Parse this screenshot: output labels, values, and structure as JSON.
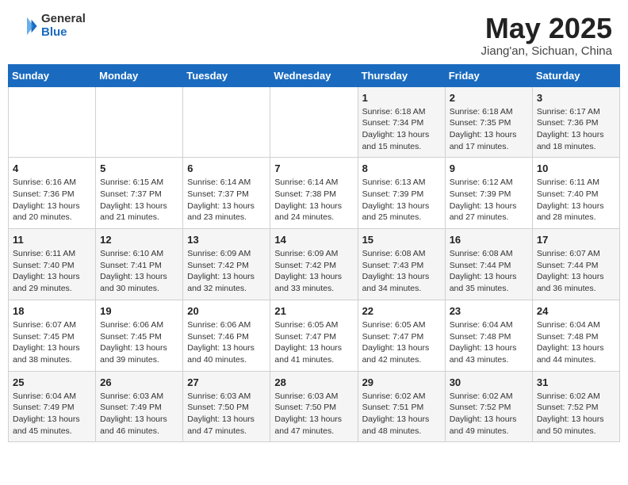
{
  "header": {
    "logo_general": "General",
    "logo_blue": "Blue",
    "title": "May 2025",
    "subtitle": "Jiang'an, Sichuan, China"
  },
  "weekdays": [
    "Sunday",
    "Monday",
    "Tuesday",
    "Wednesday",
    "Thursday",
    "Friday",
    "Saturday"
  ],
  "weeks": [
    [
      {
        "day": "",
        "info": ""
      },
      {
        "day": "",
        "info": ""
      },
      {
        "day": "",
        "info": ""
      },
      {
        "day": "",
        "info": ""
      },
      {
        "day": "1",
        "info": "Sunrise: 6:18 AM\nSunset: 7:34 PM\nDaylight: 13 hours\nand 15 minutes."
      },
      {
        "day": "2",
        "info": "Sunrise: 6:18 AM\nSunset: 7:35 PM\nDaylight: 13 hours\nand 17 minutes."
      },
      {
        "day": "3",
        "info": "Sunrise: 6:17 AM\nSunset: 7:36 PM\nDaylight: 13 hours\nand 18 minutes."
      }
    ],
    [
      {
        "day": "4",
        "info": "Sunrise: 6:16 AM\nSunset: 7:36 PM\nDaylight: 13 hours\nand 20 minutes."
      },
      {
        "day": "5",
        "info": "Sunrise: 6:15 AM\nSunset: 7:37 PM\nDaylight: 13 hours\nand 21 minutes."
      },
      {
        "day": "6",
        "info": "Sunrise: 6:14 AM\nSunset: 7:37 PM\nDaylight: 13 hours\nand 23 minutes."
      },
      {
        "day": "7",
        "info": "Sunrise: 6:14 AM\nSunset: 7:38 PM\nDaylight: 13 hours\nand 24 minutes."
      },
      {
        "day": "8",
        "info": "Sunrise: 6:13 AM\nSunset: 7:39 PM\nDaylight: 13 hours\nand 25 minutes."
      },
      {
        "day": "9",
        "info": "Sunrise: 6:12 AM\nSunset: 7:39 PM\nDaylight: 13 hours\nand 27 minutes."
      },
      {
        "day": "10",
        "info": "Sunrise: 6:11 AM\nSunset: 7:40 PM\nDaylight: 13 hours\nand 28 minutes."
      }
    ],
    [
      {
        "day": "11",
        "info": "Sunrise: 6:11 AM\nSunset: 7:40 PM\nDaylight: 13 hours\nand 29 minutes."
      },
      {
        "day": "12",
        "info": "Sunrise: 6:10 AM\nSunset: 7:41 PM\nDaylight: 13 hours\nand 30 minutes."
      },
      {
        "day": "13",
        "info": "Sunrise: 6:09 AM\nSunset: 7:42 PM\nDaylight: 13 hours\nand 32 minutes."
      },
      {
        "day": "14",
        "info": "Sunrise: 6:09 AM\nSunset: 7:42 PM\nDaylight: 13 hours\nand 33 minutes."
      },
      {
        "day": "15",
        "info": "Sunrise: 6:08 AM\nSunset: 7:43 PM\nDaylight: 13 hours\nand 34 minutes."
      },
      {
        "day": "16",
        "info": "Sunrise: 6:08 AM\nSunset: 7:44 PM\nDaylight: 13 hours\nand 35 minutes."
      },
      {
        "day": "17",
        "info": "Sunrise: 6:07 AM\nSunset: 7:44 PM\nDaylight: 13 hours\nand 36 minutes."
      }
    ],
    [
      {
        "day": "18",
        "info": "Sunrise: 6:07 AM\nSunset: 7:45 PM\nDaylight: 13 hours\nand 38 minutes."
      },
      {
        "day": "19",
        "info": "Sunrise: 6:06 AM\nSunset: 7:45 PM\nDaylight: 13 hours\nand 39 minutes."
      },
      {
        "day": "20",
        "info": "Sunrise: 6:06 AM\nSunset: 7:46 PM\nDaylight: 13 hours\nand 40 minutes."
      },
      {
        "day": "21",
        "info": "Sunrise: 6:05 AM\nSunset: 7:47 PM\nDaylight: 13 hours\nand 41 minutes."
      },
      {
        "day": "22",
        "info": "Sunrise: 6:05 AM\nSunset: 7:47 PM\nDaylight: 13 hours\nand 42 minutes."
      },
      {
        "day": "23",
        "info": "Sunrise: 6:04 AM\nSunset: 7:48 PM\nDaylight: 13 hours\nand 43 minutes."
      },
      {
        "day": "24",
        "info": "Sunrise: 6:04 AM\nSunset: 7:48 PM\nDaylight: 13 hours\nand 44 minutes."
      }
    ],
    [
      {
        "day": "25",
        "info": "Sunrise: 6:04 AM\nSunset: 7:49 PM\nDaylight: 13 hours\nand 45 minutes."
      },
      {
        "day": "26",
        "info": "Sunrise: 6:03 AM\nSunset: 7:49 PM\nDaylight: 13 hours\nand 46 minutes."
      },
      {
        "day": "27",
        "info": "Sunrise: 6:03 AM\nSunset: 7:50 PM\nDaylight: 13 hours\nand 47 minutes."
      },
      {
        "day": "28",
        "info": "Sunrise: 6:03 AM\nSunset: 7:50 PM\nDaylight: 13 hours\nand 47 minutes."
      },
      {
        "day": "29",
        "info": "Sunrise: 6:02 AM\nSunset: 7:51 PM\nDaylight: 13 hours\nand 48 minutes."
      },
      {
        "day": "30",
        "info": "Sunrise: 6:02 AM\nSunset: 7:52 PM\nDaylight: 13 hours\nand 49 minutes."
      },
      {
        "day": "31",
        "info": "Sunrise: 6:02 AM\nSunset: 7:52 PM\nDaylight: 13 hours\nand 50 minutes."
      }
    ]
  ]
}
